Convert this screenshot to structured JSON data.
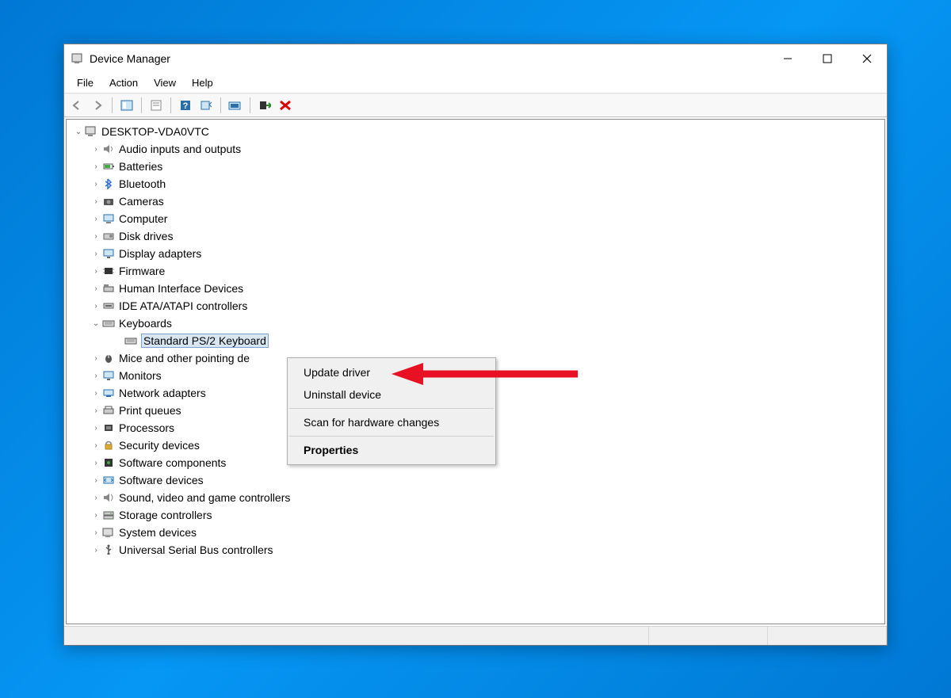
{
  "window": {
    "title": "Device Manager"
  },
  "menubar": {
    "file": "File",
    "action": "Action",
    "view": "View",
    "help": "Help"
  },
  "tree": {
    "root": "DESKTOP-VDA0VTC",
    "items": [
      "Audio inputs and outputs",
      "Batteries",
      "Bluetooth",
      "Cameras",
      "Computer",
      "Disk drives",
      "Display adapters",
      "Firmware",
      "Human Interface Devices",
      "IDE ATA/ATAPI controllers",
      "Keyboards",
      "Mice and other pointing de",
      "Monitors",
      "Network adapters",
      "Print queues",
      "Processors",
      "Security devices",
      "Software components",
      "Software devices",
      "Sound, video and game controllers",
      "Storage controllers",
      "System devices",
      "Universal Serial Bus controllers"
    ],
    "selected_child": "Standard PS/2 Keyboard"
  },
  "context_menu": {
    "update": "Update driver",
    "uninstall": "Uninstall device",
    "scan": "Scan for hardware changes",
    "properties": "Properties"
  }
}
